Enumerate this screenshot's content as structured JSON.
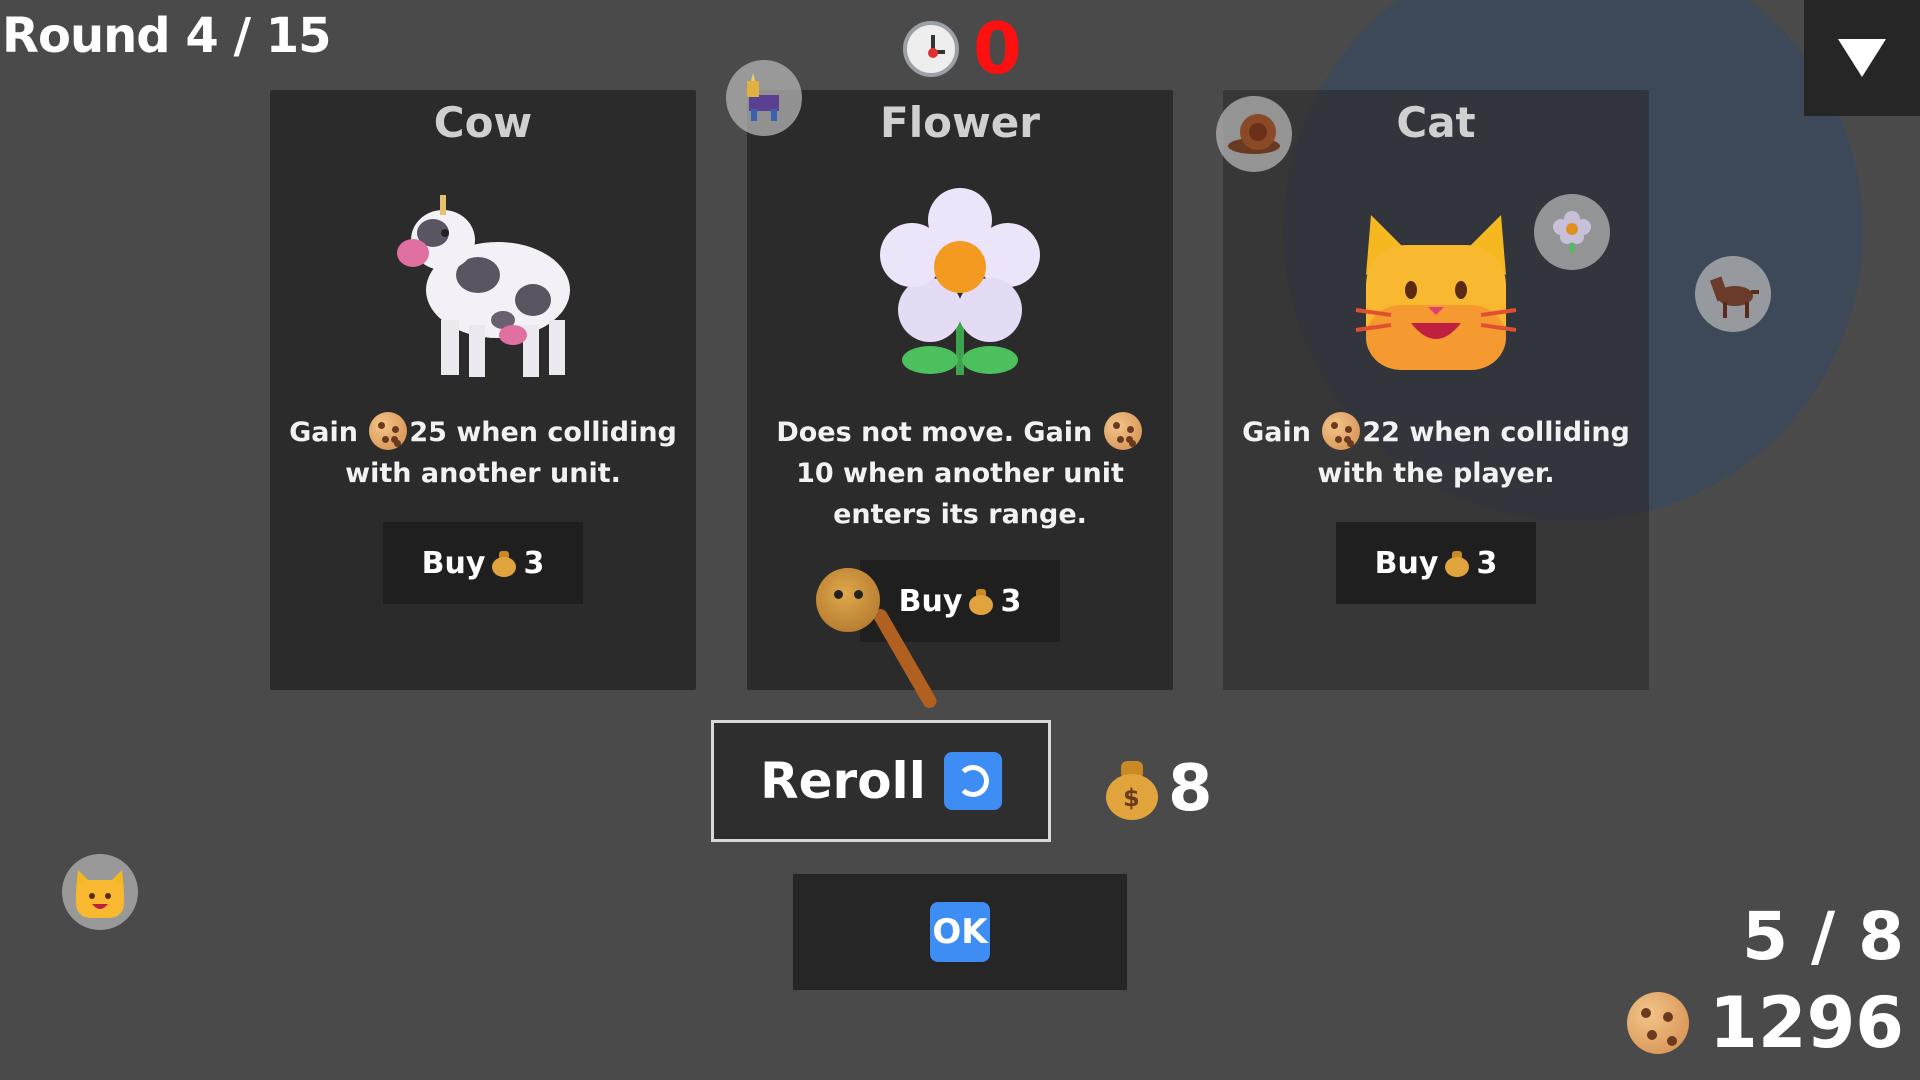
{
  "hud": {
    "round_label": "Round 4 / 15",
    "timer_value": "0",
    "unit_count": "5 / 8",
    "cookies": "1296",
    "money": "8"
  },
  "shop": {
    "cards": [
      {
        "name": "Cow",
        "desc_before": "Gain ",
        "desc_after": "25 when colliding with another unit.",
        "price": "3",
        "buy_label": "Buy",
        "icon": "cow-icon"
      },
      {
        "name": "Flower",
        "desc_before": "Does not move. Gain ",
        "desc_after": "10 when another unit enters its range.",
        "price": "3",
        "buy_label": "Buy",
        "icon": "flower-icon"
      },
      {
        "name": "Cat",
        "desc_before": "Gain ",
        "desc_after": "22 when colliding with the player.",
        "price": "3",
        "buy_label": "Buy",
        "icon": "cat-face-icon"
      }
    ],
    "reroll_label": "Reroll",
    "ok_label": "OK"
  },
  "board_units": [
    "unicorn-icon",
    "snail-icon",
    "flower-icon",
    "horse-icon",
    "cat-face-icon",
    "player-ball-icon"
  ],
  "colors": {
    "background": "#4a4a4a",
    "card": "#2b2b2b",
    "button": "#1f1f1f",
    "range_circle": "#3a485c",
    "timer": "#ff1010",
    "accent_blue": "#3d8df5"
  }
}
